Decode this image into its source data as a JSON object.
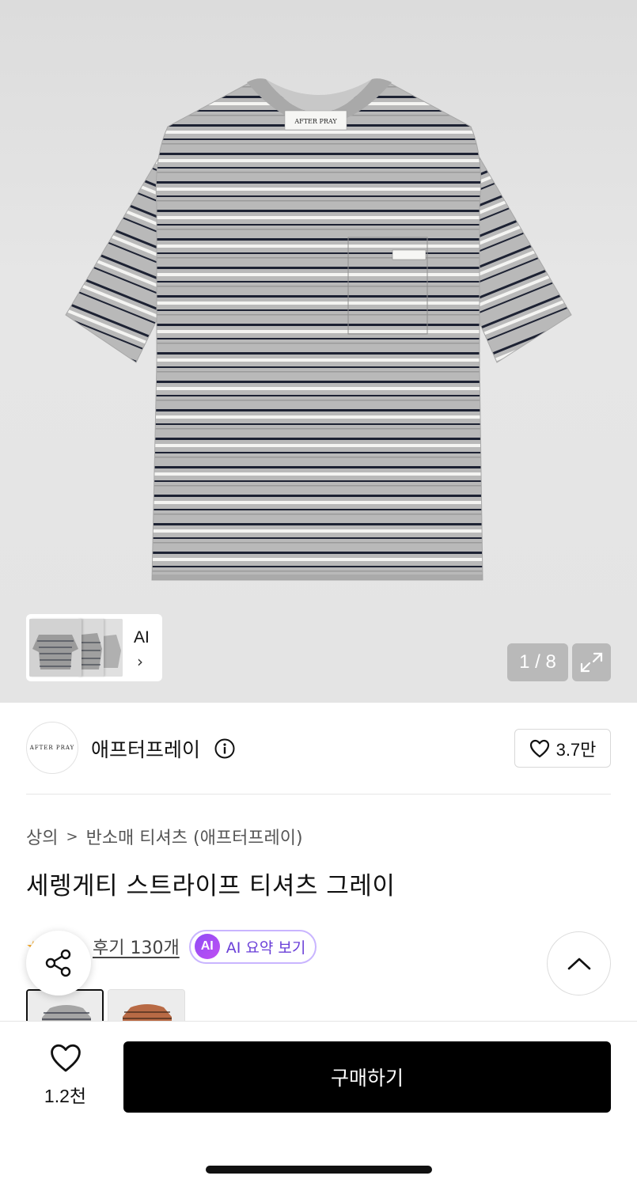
{
  "product_image": {
    "label_text": "AFTER PRAY",
    "counter": "1 / 8",
    "thumb_ai_label": "AI",
    "thumb_chevron": "›",
    "expand_icon": "expand-icon"
  },
  "brand": {
    "logo_text": "AFTER PRAY",
    "name": "애프터프레이",
    "like_count": "3.7만"
  },
  "breadcrumb": {
    "items": [
      "상의",
      "반소매 티셔츠 (애프터프레이)"
    ],
    "separator": ">"
  },
  "product": {
    "title": "세렝게티 스트라이프 티셔츠 그레이"
  },
  "reviews": {
    "stars": "★",
    "link_text": "후기 130개",
    "ai_badge": "AI",
    "ai_summary": "AI 요약 보기"
  },
  "bottom": {
    "wish_count": "1.2천",
    "buy_label": "구매하기"
  },
  "colors": {
    "accent_purple": "#6a3fd8",
    "star": "#f5a623",
    "buy_button": "#000000"
  }
}
